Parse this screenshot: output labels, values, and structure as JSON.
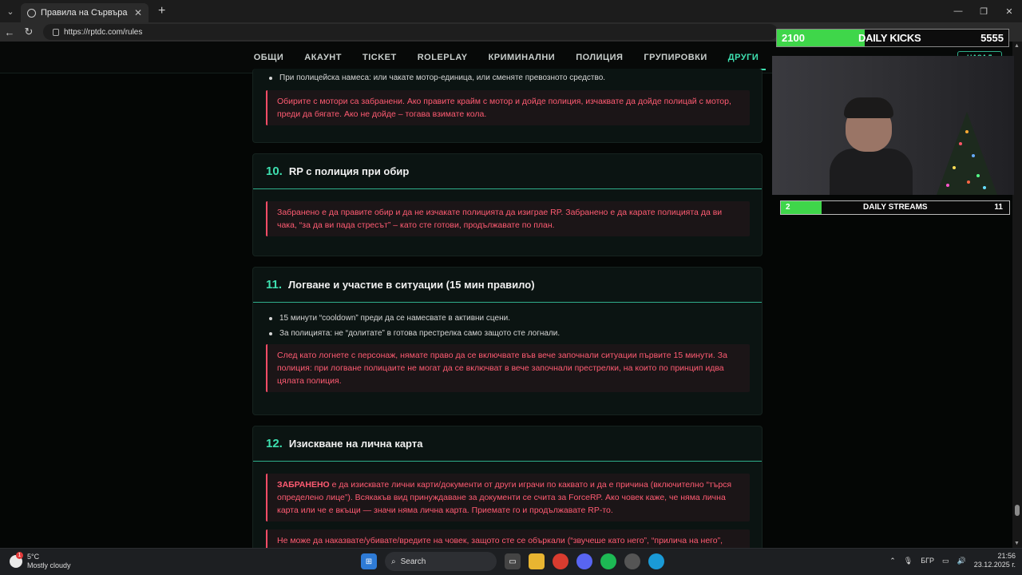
{
  "browser": {
    "tab_title": "Правила на Сървъра | TDC Rolep",
    "url": "https://rptdc.com/rules"
  },
  "site_nav": {
    "items": [
      "ОБЩИ",
      "АКАУНТ",
      "TICKET",
      "ROLEPLAY",
      "КРИМИНАЛНИ",
      "ПОЛИЦИЯ",
      "ГРУПИРОВКИ",
      "ДРУГИ"
    ],
    "active": "ДРУГИ"
  },
  "card9": {
    "bullet": "При полицейска намеса: или чакате мотор-единица, или сменяте превозното средство.",
    "warning": "Обирите с мотори са забранени. Ако правите крайм с мотор и дойде полиция, изчаквате да дойде полицай с мотор, преди да бягате. Ако не дойде – тогава взимате кола."
  },
  "card10": {
    "number": "10.",
    "title": "RP с полиция при обир",
    "warning": "Забранено е да правите обир и да не изчакате полицията да изиграе RP. Забранено е да карате полицията да ви чака, “за да ви пада стресът” – като сте готови, продължавате по план."
  },
  "card11": {
    "number": "11.",
    "title": "Логване и участие в ситуации (15 мин правило)",
    "bullet1": "15 минути “cooldown” преди да се намесвате в активни сцени.",
    "bullet2": "За полицията: не “долитате” в готова престрелка само защото сте логнали.",
    "warning": "След като логнете с персонаж, нямате право да се включвате във вече започнали ситуации първите 15 минути. За полиция: при логване полицаите не могат да се включват в вече започнали престрелки, на които по принцип идва цялата полиция."
  },
  "card12": {
    "number": "12.",
    "title": "Изискване на лична карта",
    "warning_strong": "ЗАБРАНЕНО",
    "warning_rest": " е да изисквате лични карти/документи от други играчи по каквато и да е причина (включително “търся определено лице”). Всякакъв вид принуждаване за документи се счита за ForceRP. Ако човек каже, че няма лична карта или че е вкъщи — значи няма лична карта. Приемате го и продължавате RP-то.",
    "warning2": "Не може да наказвате/убивате/вредите на човек, защото сте се объркали (“звучеше като него”, “прилича на него”,"
  },
  "overlay": {
    "kicks_current": "2100",
    "kicks_label": "DAILY KICKS",
    "kicks_goal": "5555",
    "kicks_progress": 0.38,
    "streams_current": "2",
    "streams_label": "DAILY STREAMS",
    "streams_goal": "11",
    "streams_progress": 0.18,
    "nazad_label": "НАЗАД"
  },
  "taskbar": {
    "temp": "5°C",
    "weather": "Mostly cloudy",
    "weather_badge": "1",
    "search_label": "Search",
    "lang": "БГР",
    "time": "21:56",
    "date": "23.12.2025 г."
  },
  "colors": {
    "accent": "#3ee0b0",
    "warning": "#ff5b72",
    "progress": "#3fd64a"
  }
}
